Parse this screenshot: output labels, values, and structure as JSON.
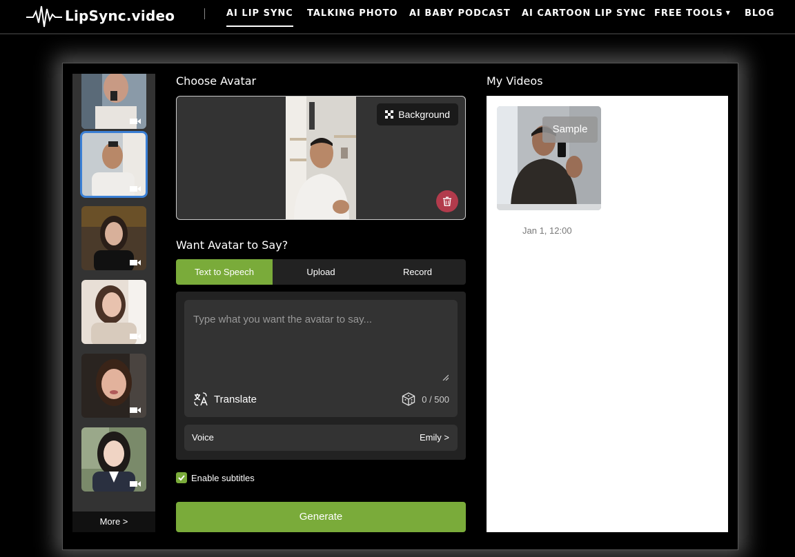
{
  "brand": {
    "name": "LipSync.video"
  },
  "nav": {
    "items": [
      {
        "label": "AI LIP SYNC"
      },
      {
        "label": "TALKING PHOTO"
      },
      {
        "label": "AI BABY PODCAST"
      },
      {
        "label": "AI CARTOON LIP SYNC"
      },
      {
        "label": "FREE TOOLS"
      },
      {
        "label": "BLOG"
      }
    ],
    "active_index": 0
  },
  "sidebar": {
    "selected_index": 1,
    "avatars": [
      {
        "name": "man-holding-mic"
      },
      {
        "name": "man-white-sweater"
      },
      {
        "name": "woman-dark-hair"
      },
      {
        "name": "woman-lace-top"
      },
      {
        "name": "woman-selfie"
      },
      {
        "name": "girl-school-uniform"
      }
    ],
    "more_label": "More >"
  },
  "avatar_section": {
    "title": "Choose Avatar",
    "background_label": "Background"
  },
  "say_section": {
    "title": "Want Avatar to Say?",
    "tabs": [
      {
        "label": "Text to Speech"
      },
      {
        "label": "Upload"
      },
      {
        "label": "Record"
      }
    ],
    "active_tab": 0,
    "text_value": "",
    "text_placeholder": "Type what you want the avatar to say...",
    "translate_label": "Translate",
    "char_count": "0 / 500",
    "voice_label": "Voice",
    "voice_value": "Emily >"
  },
  "subtitles": {
    "label": "Enable subtitles",
    "checked": true
  },
  "generate_label": "Generate",
  "my_videos": {
    "title": "My Videos",
    "items": [
      {
        "badge": "Sample",
        "date": "Jan 1, 12:00"
      }
    ]
  },
  "colors": {
    "accent": "#7aab3a",
    "danger": "#b23b4c",
    "selected": "#3a7fd4"
  }
}
